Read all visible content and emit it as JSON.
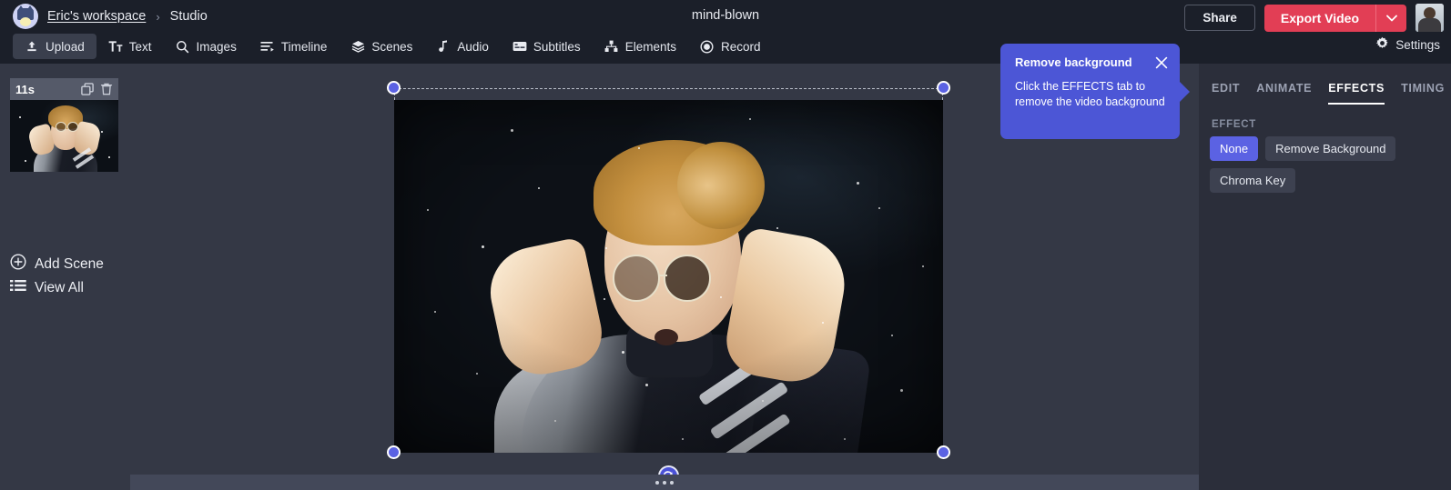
{
  "header": {
    "workspace_link": "Eric's workspace",
    "breadcrumb_separator": "›",
    "section": "Studio",
    "project_title": "mind-blown",
    "share_label": "Share",
    "export_label": "Export Video",
    "settings_label": "Settings",
    "logo_icon": "workspace-cat-logo",
    "avatar_icon": "user-avatar",
    "export_caret_icon": "chevron-down-icon"
  },
  "nav": {
    "items": [
      {
        "label": "Upload",
        "icon": "upload-icon",
        "active": true
      },
      {
        "label": "Text",
        "icon": "text-icon",
        "active": false
      },
      {
        "label": "Images",
        "icon": "search-icon",
        "active": false
      },
      {
        "label": "Timeline",
        "icon": "timeline-icon",
        "active": false
      },
      {
        "label": "Scenes",
        "icon": "layers-icon",
        "active": false
      },
      {
        "label": "Audio",
        "icon": "music-note-icon",
        "active": false
      },
      {
        "label": "Subtitles",
        "icon": "subtitles-icon",
        "active": false
      },
      {
        "label": "Elements",
        "icon": "elements-icon",
        "active": false
      },
      {
        "label": "Record",
        "icon": "record-icon",
        "active": false
      }
    ]
  },
  "sidebar": {
    "scene": {
      "duration": "11s",
      "duplicate_icon": "copy-icon",
      "delete_icon": "trash-icon",
      "thumbnail_alt": "scene-thumbnail"
    },
    "add_scene_label": "Add Scene",
    "add_scene_icon": "plus-circle-icon",
    "view_all_label": "View All",
    "view_all_icon": "list-icon"
  },
  "canvas": {
    "selection": {
      "handles": [
        "top-left",
        "top-right",
        "bottom-left",
        "bottom-right"
      ],
      "rotate_icon": "rotate-icon"
    },
    "resize_grip_icon": "drag-dots-icon"
  },
  "tooltip": {
    "title": "Remove background",
    "body": "Click the EFFECTS tab to remove the video background",
    "close_icon": "close-icon",
    "color": "#4c56d6"
  },
  "right_panel": {
    "tabs": [
      {
        "label": "EDIT",
        "active": false
      },
      {
        "label": "ANIMATE",
        "active": false
      },
      {
        "label": "EFFECTS",
        "active": true
      },
      {
        "label": "TIMING",
        "active": false
      }
    ],
    "effect_section_label": "EFFECT",
    "effect_options": [
      {
        "label": "None",
        "selected": true
      },
      {
        "label": "Remove Background",
        "selected": false
      },
      {
        "label": "Chroma Key",
        "selected": false
      }
    ]
  },
  "colors": {
    "header_bg": "#1b1f29",
    "app_bg": "#343845",
    "panel_bg": "#2b2e3a",
    "accent_red": "#e23e55",
    "accent_blue": "#5b62e3",
    "chip_bg": "#3d4150"
  }
}
